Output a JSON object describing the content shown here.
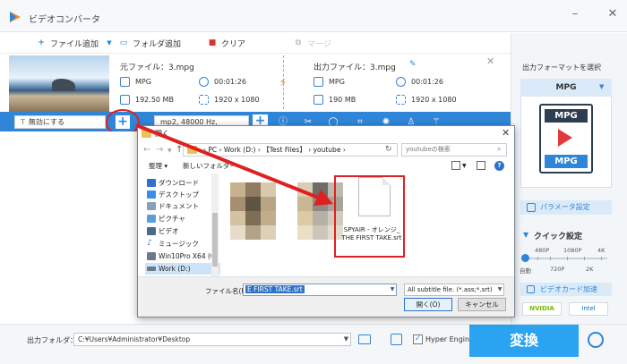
{
  "app": {
    "title": "ビデオコンバータ"
  },
  "toolbar": {
    "add_file": "ファイル追加",
    "add_folder": "フォルダ追加",
    "clear": "クリア",
    "merge": "マージ"
  },
  "source": {
    "label": "元ファイル：3.mpg",
    "format": "MPG",
    "duration": "00:01:26",
    "size": "192.50 MB",
    "resolution": "1920 x 1080"
  },
  "output": {
    "label": "出力ファイル：3.mpg",
    "format": "MPG",
    "duration": "00:01:26",
    "size": "190 MB",
    "resolution": "1920 x 1080"
  },
  "subtitle_bar": {
    "subtitle_select": "無効にする",
    "audio_select": "mp2, 48000 Hz,"
  },
  "right_panel": {
    "title": "出力フォーマットを選択",
    "format": "MPG",
    "format_doc_top": "MPG",
    "format_doc_bottom": "MPG",
    "param_button": "パラメータ設定",
    "quick_title": "クイック設定",
    "quality_top": [
      "480P",
      "1080P",
      "4K"
    ],
    "quality_bottom": [
      "自動",
      "720P",
      "2K"
    ],
    "quality_level": "auto",
    "gpu_accel": "ビデオカード加速",
    "vendors": [
      "NVIDIA",
      "Intel"
    ]
  },
  "dialog": {
    "title": "開く",
    "address": "›  PC  ›  Work (D:)  ›  【Test Files】 ›  youtube  ›",
    "search_placeholder": "youtubeの検索",
    "organize": "整理 ▾",
    "new_folder": "新しいフォルダー",
    "nav_items": [
      {
        "label": "ダウンロード",
        "color": "#2f72c9"
      },
      {
        "label": "デスクトップ",
        "color": "#3a8ee6"
      },
      {
        "label": "ドキュメント",
        "color": "#8aa0b6"
      },
      {
        "label": "ピクチャ",
        "color": "#5aa0d8"
      },
      {
        "label": "ビデオ",
        "color": "#4a6a8a"
      },
      {
        "label": "ミュージック",
        "color": "#2f72c9"
      },
      {
        "label": "Win10Pro X64 (C",
        "color": "#6a7a8a"
      },
      {
        "label": "Work (D:)",
        "color": "#6a7a8a"
      }
    ],
    "file_name": "SPYAIR - オレンジ_ THE FIRST TAKE.srt",
    "filename_label": "ファイル名(N):",
    "filename_value": "E FIRST TAKE.srt",
    "filetype_value": "All subtitle file. (*.ass;*.srt)",
    "open_button": "開く(O)",
    "cancel_button": "キャンセル"
  },
  "bottom": {
    "output_label": "出力フォルダ：",
    "output_path": "C:¥Users¥Administrator¥Desktop",
    "hyper_engine": "Hyper Engine",
    "hyper_checked": true,
    "convert_button": "変換"
  },
  "colors": {
    "accent": "#2f86d8",
    "convert": "#2aa3f0",
    "highlight_red": "#e02020"
  }
}
